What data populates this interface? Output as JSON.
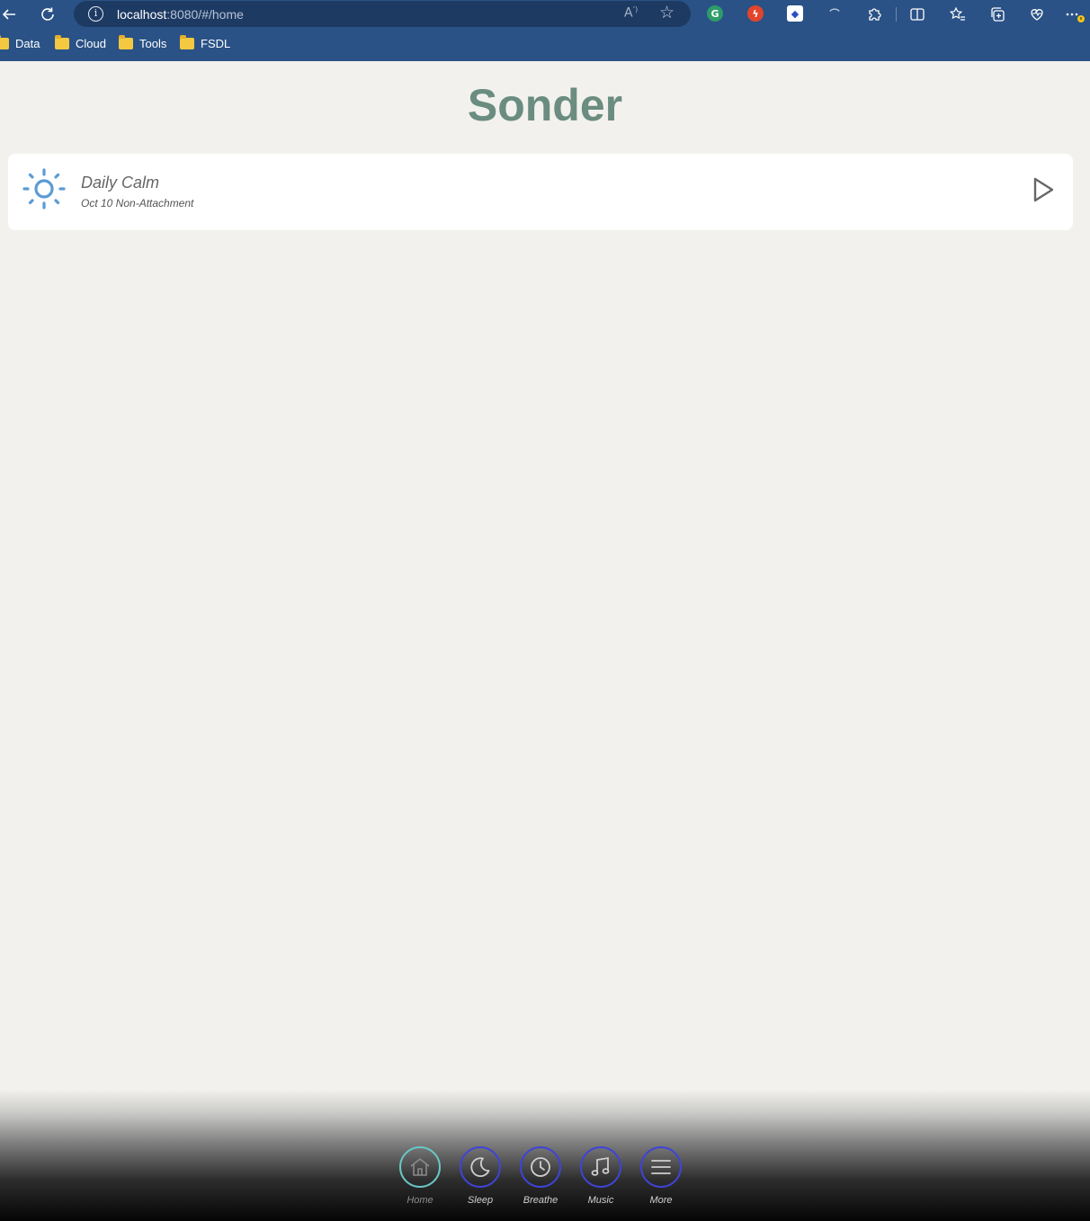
{
  "browser": {
    "url_host": "localhost",
    "url_rest": ":8080/#/home",
    "bookmarks": [
      {
        "label": "Data"
      },
      {
        "label": "Cloud"
      },
      {
        "label": "Tools"
      },
      {
        "label": "FSDL"
      }
    ]
  },
  "app": {
    "title": "Sonder"
  },
  "daily_card": {
    "title": "Daily Calm",
    "subtitle": "Oct 10 Non-Attachment",
    "icon": "sun-icon"
  },
  "nav": {
    "items": [
      {
        "label": "Home",
        "icon": "home-icon",
        "active": true
      },
      {
        "label": "Sleep",
        "icon": "moon-icon",
        "active": false
      },
      {
        "label": "Breathe",
        "icon": "clock-icon",
        "active": false
      },
      {
        "label": "Music",
        "icon": "music-note-icon",
        "active": false
      },
      {
        "label": "More",
        "icon": "menu-icon",
        "active": false
      }
    ]
  },
  "colors": {
    "title": "#6b8c80",
    "sun": "#5b9bd5",
    "nav_ring": "#3f44d6",
    "nav_ring_active": "#6ac6c6",
    "chrome": "#2a5286"
  }
}
